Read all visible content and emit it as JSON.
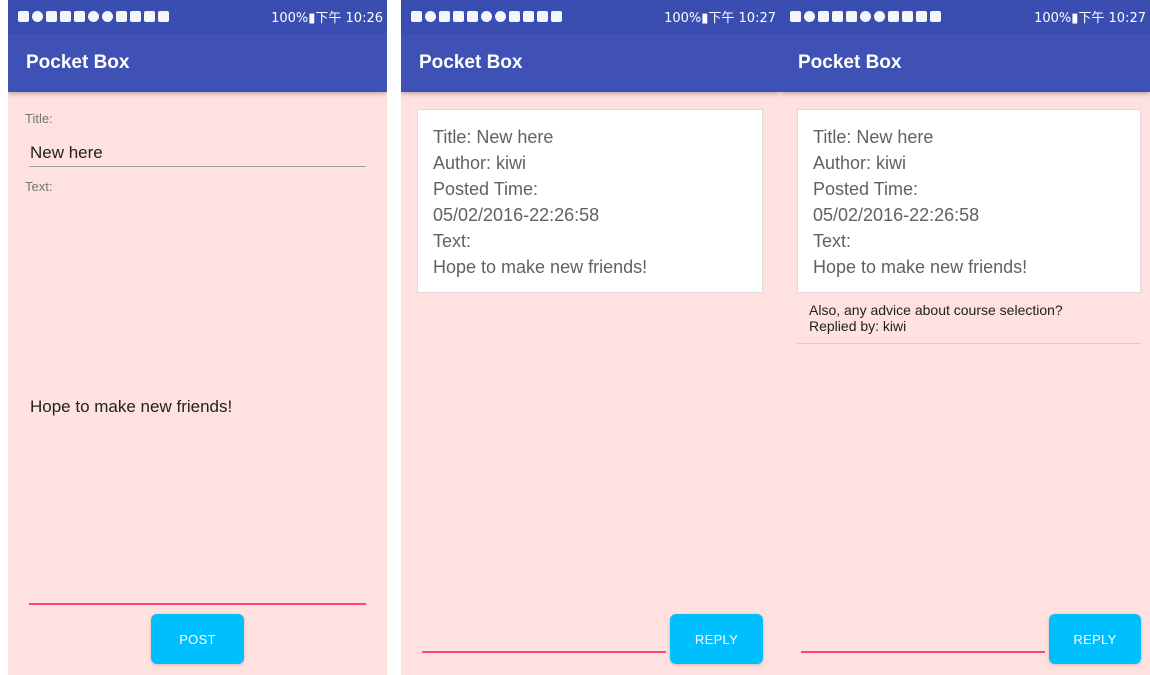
{
  "status_bar": {
    "screen1": "100%▮下午 10:26",
    "screen2": "100%▮下午 10:27",
    "screen3": "100%▮下午 10:27"
  },
  "app": {
    "title": "Pocket Box"
  },
  "compose": {
    "title_label": "Title:",
    "title_value": "New here",
    "text_label": "Text:",
    "text_value": "Hope to make new friends!",
    "post_button": "POST"
  },
  "post_detail": {
    "title_line": "Title: New here",
    "author_line": "Author: kiwi",
    "posted_time_label": "Posted Time:",
    "posted_time_value": "05/02/2016-22:26:58",
    "text_label": "Text:",
    "text_value": "Hope to make new friends!",
    "reply_button": "REPLY"
  },
  "replies": [
    {
      "text": "Also, any advice about course selection?",
      "replied_by": "Replied by: kiwi"
    }
  ],
  "colors": {
    "app_bar": "#3f51b5",
    "background": "#ffe2e0",
    "accent": "#ff4081",
    "button": "#00bfff"
  }
}
